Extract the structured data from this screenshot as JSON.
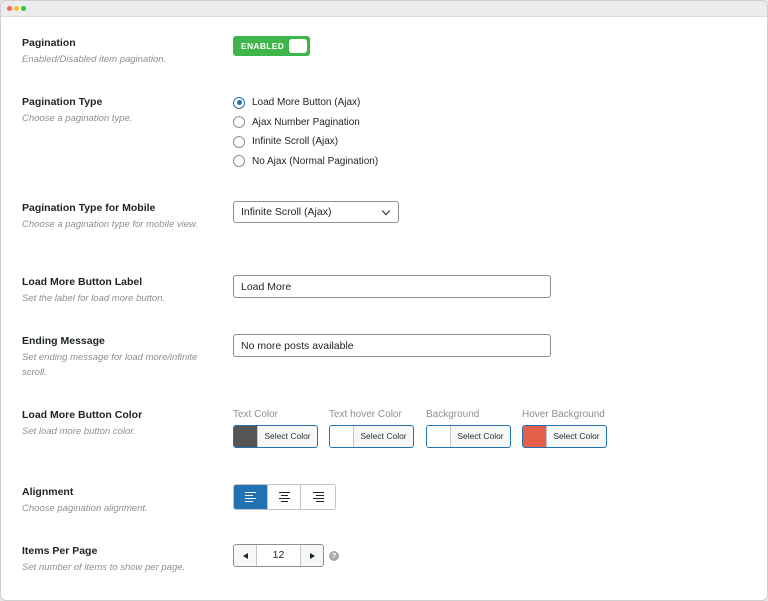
{
  "pagination": {
    "title": "Pagination",
    "desc": "Enabled/Disabled item pagination.",
    "toggle_label": "ENABLED",
    "enabled": true
  },
  "pagination_type": {
    "title": "Pagination Type",
    "desc": "Choose a pagination type.",
    "options": [
      {
        "label": "Load More Button (Ajax)",
        "checked": true
      },
      {
        "label": "Ajax Number Pagination",
        "checked": false
      },
      {
        "label": "Infinite Scroll (Ajax)",
        "checked": false
      },
      {
        "label": "No Ajax (Normal Pagination)",
        "checked": false
      }
    ]
  },
  "pagination_type_mobile": {
    "title": "Pagination Type for Mobile",
    "desc": "Choose a pagination type for mobile view.",
    "selected": "Infinite Scroll (Ajax)"
  },
  "load_more_label": {
    "title": "Load More Button Label",
    "desc": "Set the label for load more button.",
    "value": "Load More"
  },
  "ending_message": {
    "title": "Ending Message",
    "desc": "Set ending message for load more/infinite scroll.",
    "value": "No more posts available"
  },
  "button_color": {
    "title": "Load More Button Color",
    "desc": "Set load more button color.",
    "pickers": [
      {
        "title": "Text Color",
        "button_label": "Select Color",
        "color": "#555555"
      },
      {
        "title": "Text hover Color",
        "button_label": "Select Color",
        "color": "#ffffff"
      },
      {
        "title": "Background",
        "button_label": "Select Color",
        "color": "#ffffff"
      },
      {
        "title": "Hover Background",
        "button_label": "Select Color",
        "color": "#e5604a"
      }
    ]
  },
  "alignment": {
    "title": "Alignment",
    "desc": "Choose pagination alignment.",
    "options": [
      {
        "icon": "align-left-icon",
        "active": true
      },
      {
        "icon": "align-center-icon",
        "active": false
      },
      {
        "icon": "align-right-icon",
        "active": false
      }
    ]
  },
  "items_per_page": {
    "title": "Items Per Page",
    "desc": "Set number of items to show per page.",
    "value": "12",
    "help_symbol": "?"
  },
  "theme": {
    "accent": "#2271b1",
    "toggle_on": "#3fb64b"
  }
}
